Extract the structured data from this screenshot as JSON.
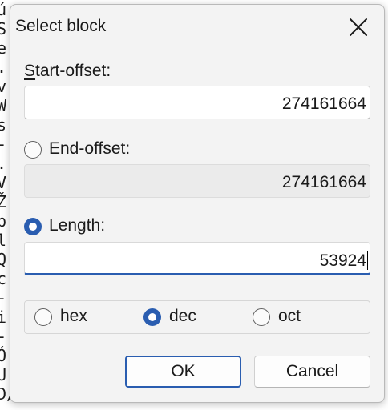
{
  "background_glyphs": [
    "ú",
    "S",
    "e",
    ".",
    "v",
    "W",
    "s",
    "-",
    ".",
    "V",
    "Ž",
    "p",
    "l",
    "Q",
    "c",
    "-",
    "i",
    "-",
    "Ó",
    "U",
    "D/Y"
  ],
  "dialog": {
    "title": "Select block",
    "close_icon": "close-icon"
  },
  "start_offset": {
    "label": "Start-offset:",
    "mnemonic": "S",
    "label_rest": "tart-offset:",
    "value": "274161664"
  },
  "end_offset": {
    "label": "End-offset:",
    "value": "274161664",
    "selected": false,
    "disabled": true
  },
  "length": {
    "label": "Length:",
    "value": "53924",
    "selected": true,
    "focused": true
  },
  "base": {
    "options": [
      {
        "label": "hex",
        "selected": false
      },
      {
        "label": "dec",
        "selected": true
      },
      {
        "label": "oct",
        "selected": false
      }
    ]
  },
  "buttons": {
    "ok_label": "OK",
    "cancel_label": "Cancel"
  },
  "colors": {
    "accent": "#2a5db0",
    "dialog_bg": "#f3f3f3",
    "disabled_field": "#ebebeb"
  }
}
